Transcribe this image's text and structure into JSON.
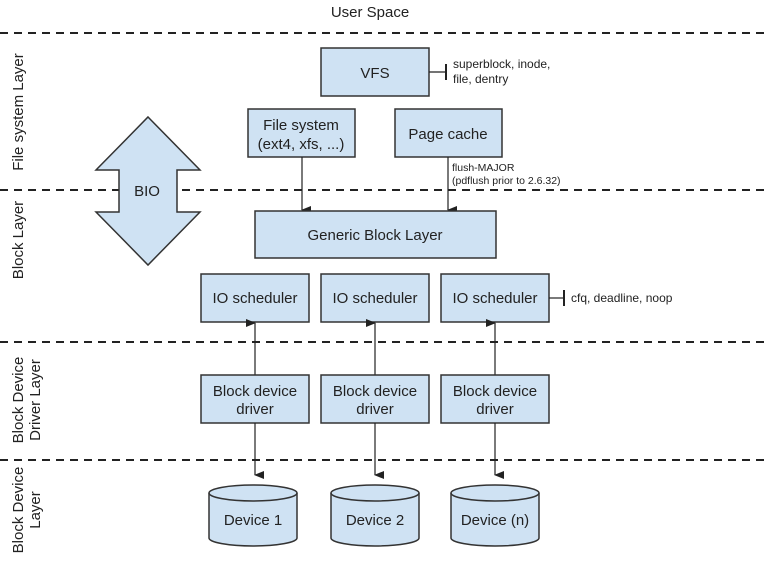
{
  "top_label": "User Space",
  "layers": {
    "fs": "File system Layer",
    "block": "Block Layer",
    "driver_line1": "Block Device",
    "driver_line2": "Driver Layer",
    "device_line1": "Block Device",
    "device_line2": "Layer"
  },
  "nodes": {
    "vfs": "VFS",
    "filesystem_line1": "File system",
    "filesystem_line2": "(ext4, xfs, ...)",
    "page_cache": "Page cache",
    "generic_block": "Generic Block Layer",
    "bio": "BIO",
    "schedulers": [
      "IO scheduler",
      "IO scheduler",
      "IO scheduler"
    ],
    "drivers": [
      {
        "line1": "Block device",
        "line2": "driver"
      },
      {
        "line1": "Block device",
        "line2": "driver"
      },
      {
        "line1": "Block device",
        "line2": "driver"
      }
    ],
    "devices": [
      "Device 1",
      "Device 2",
      "Device (n)"
    ]
  },
  "annotations": {
    "vfs_line1": "superblock, inode,",
    "vfs_line2": "file, dentry",
    "flush_line1": "flush-MAJOR",
    "flush_line2": "(pdflush prior to 2.6.32)",
    "scheduler": "cfq, deadline, noop"
  },
  "colors": {
    "box_fill": "#cfe2f3",
    "stroke": "#333333"
  }
}
